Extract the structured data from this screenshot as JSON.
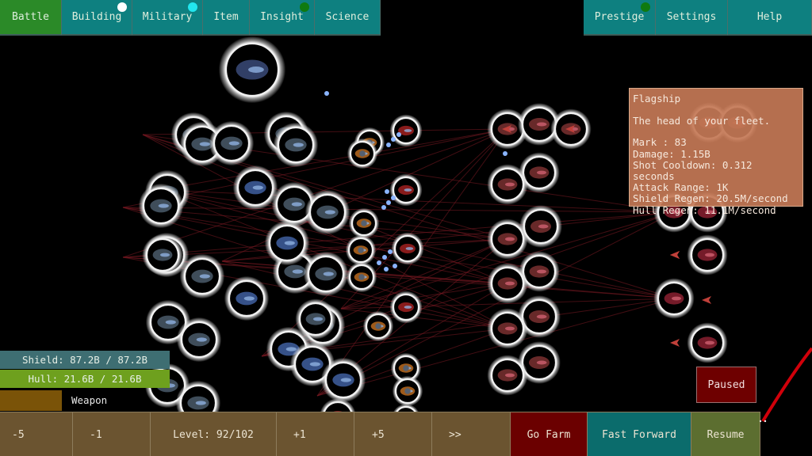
{
  "top_tabs_left": [
    {
      "label": "Battle",
      "active": true,
      "badge": null
    },
    {
      "label": "Building",
      "active": false,
      "badge": "#ffffff"
    },
    {
      "label": "Military",
      "active": false,
      "badge": "#22e6ee"
    },
    {
      "label": "Item",
      "active": false,
      "badge": null
    },
    {
      "label": "Insight",
      "active": false,
      "badge": "#0f7a10"
    },
    {
      "label": "Science",
      "active": false,
      "badge": null
    }
  ],
  "top_tabs_right": [
    {
      "label": "Prestige",
      "badge": "#0f7a10"
    },
    {
      "label": "Settings",
      "badge": null
    },
    {
      "label": "Help",
      "badge": null
    }
  ],
  "tooltip": {
    "title": "Flagship",
    "description": "The head of your fleet.",
    "stats": [
      "Mark : 83",
      "Damage: 1.15B",
      "Shot Cooldown: 0.312 seconds",
      "Attack Range: 1K",
      "Shield Regen: 20.5M/second",
      "Hull Regen: 11.1M/second"
    ]
  },
  "player_status": {
    "shield": "Shield: 87.2B / 87.2B",
    "hull": "Hull: 21.6B / 21.6B",
    "weapon_label": "Weapon"
  },
  "paused_label": "Paused",
  "bottom_bar": {
    "minus5": "-5",
    "minus1": "-1",
    "level": "Level: 92/102",
    "plus1": "+1",
    "plus5": "+5",
    "skip": ">>",
    "go_farm": "Go Farm",
    "fast_forward": "Fast Forward",
    "resume": "Resume"
  },
  "colors": {
    "tab_teal": "#0e8080",
    "tab_active_green": "#2b8a28",
    "tooltip_bg": "#c47856",
    "shield_bar": "#3e6e72",
    "hull_bar": "#6ea01e",
    "bottom_brown": "#6b5430",
    "farm_red": "#6b0000",
    "ff_teal": "#0b6c6c",
    "resume_olive": "#5c6e30"
  },
  "battlefield": {
    "player_ships": [
      {
        "kind": "flagship"
      },
      {
        "kind": "cruiser"
      },
      {
        "kind": "cruiser"
      },
      {
        "kind": "cruiser"
      },
      {
        "kind": "cruiser"
      },
      {
        "kind": "cruiser"
      },
      {
        "kind": "cruiser"
      },
      {
        "kind": "cruiser"
      },
      {
        "kind": "cruiser"
      },
      {
        "kind": "cruiser"
      },
      {
        "kind": "cruiser"
      },
      {
        "kind": "cruiser"
      },
      {
        "kind": "cruiser"
      },
      {
        "kind": "cruiser"
      },
      {
        "kind": "cruiser"
      },
      {
        "kind": "cruiser"
      },
      {
        "kind": "cruiser"
      },
      {
        "kind": "cruiser"
      },
      {
        "kind": "cruiser"
      },
      {
        "kind": "cruiser"
      },
      {
        "kind": "cruiser"
      },
      {
        "kind": "carrier"
      },
      {
        "kind": "carrier"
      },
      {
        "kind": "carrier"
      },
      {
        "kind": "carrier"
      },
      {
        "kind": "carrier"
      },
      {
        "kind": "carrier"
      },
      {
        "kind": "drone"
      },
      {
        "kind": "drone"
      },
      {
        "kind": "drone"
      },
      {
        "kind": "drone"
      },
      {
        "kind": "drone"
      },
      {
        "kind": "drone"
      },
      {
        "kind": "drone"
      },
      {
        "kind": "drone"
      },
      {
        "kind": "red-frigate"
      },
      {
        "kind": "red-frigate"
      },
      {
        "kind": "red-frigate"
      },
      {
        "kind": "red-frigate"
      },
      {
        "kind": "red-frigate"
      },
      {
        "kind": "red-frigate"
      }
    ],
    "enemy_ships": [
      {
        "kind": "enemy-frigate"
      },
      {
        "kind": "enemy-frigate"
      },
      {
        "kind": "enemy-frigate"
      },
      {
        "kind": "enemy-frigate"
      },
      {
        "kind": "enemy-frigate"
      },
      {
        "kind": "enemy-frigate"
      },
      {
        "kind": "enemy-frigate"
      },
      {
        "kind": "enemy-frigate"
      },
      {
        "kind": "enemy-frigate"
      },
      {
        "kind": "enemy-frigate"
      },
      {
        "kind": "enemy-frigate"
      },
      {
        "kind": "enemy-frigate"
      },
      {
        "kind": "enemy-frigate"
      },
      {
        "kind": "enemy-frigate"
      },
      {
        "kind": "enemy-frigate"
      },
      {
        "kind": "enemy-frigate"
      },
      {
        "kind": "enemy-frigate"
      },
      {
        "kind": "enemy-heavy"
      },
      {
        "kind": "enemy-heavy"
      },
      {
        "kind": "enemy-heavy"
      },
      {
        "kind": "enemy-heavy"
      },
      {
        "kind": "enemy-heavy"
      },
      {
        "kind": "enemy-heavy"
      },
      {
        "kind": "enemy-heavy"
      },
      {
        "kind": "enemy-fighter"
      },
      {
        "kind": "enemy-fighter"
      },
      {
        "kind": "enemy-fighter"
      },
      {
        "kind": "enemy-fighter"
      }
    ]
  }
}
